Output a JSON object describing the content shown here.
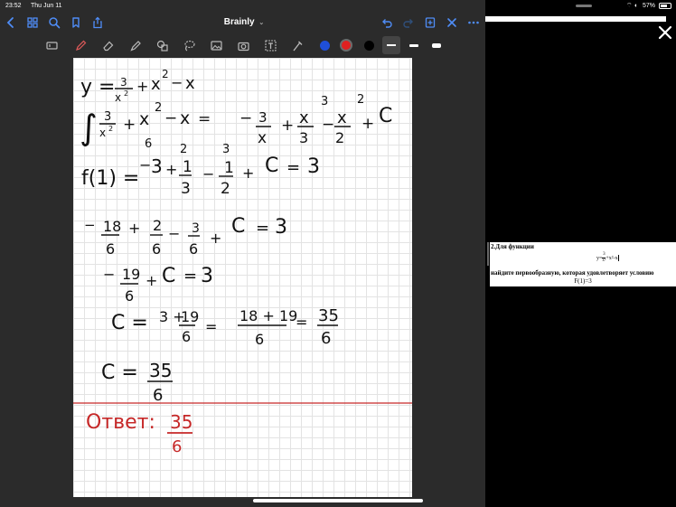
{
  "status_bar": {
    "time": "23:52",
    "date": "Thu Jun 11",
    "battery": "57%"
  },
  "navbar": {
    "title": "Brainly"
  },
  "toolbar": {
    "tools": [
      "text-tool",
      "pen",
      "eraser",
      "highlighter",
      "shapes",
      "lasso",
      "image",
      "camera",
      "textbox",
      "laser"
    ]
  },
  "colors": {
    "ink_blue": "#1f4fd8",
    "ink_red": "#e02020",
    "ink_black": "#000000",
    "answer_red": "#c62828",
    "paper_line": "#e3e3e3"
  },
  "notes": {
    "line1": {
      "y": "y =",
      "frac_num": "3",
      "frac_den": "x",
      "den_exp": "2",
      "plus1": "+",
      "x2_base": "x",
      "x2_exp": "2",
      "minus": "−",
      "x_last": "x"
    },
    "line2": {
      "integral": "∫",
      "i_num": "3",
      "i_den": "x",
      "i_den_exp": "2",
      "plus1": "+",
      "x2_base": "x",
      "x2_exp": "2",
      "minus1": "−",
      "x1": "x",
      "eq": "=",
      "neg": "−",
      "r1_num": "3",
      "r1_den": "x",
      "plus2": "+",
      "r2_num": "x",
      "r2_num_exp": "3",
      "r2_den": "3",
      "minus2": "−",
      "r3_num": "x",
      "r3_num_exp": "2",
      "r3_den": "2",
      "plus3": "+",
      "c": "C"
    },
    "line3": {
      "f": "f(1) =",
      "neg": "−",
      "three": "3",
      "scale1": "6",
      "plus1": "+",
      "a_num": "1",
      "a_den": "3",
      "scale2": "2",
      "minus": "−",
      "b_num": "1",
      "b_den": "2",
      "scale3": "3",
      "plus2": "+",
      "c": "C",
      "eq": "=",
      "val": "3"
    },
    "line4": {
      "neg": "−",
      "a_num": "18",
      "a_den": "6",
      "plus1": "+",
      "b_num": "2",
      "b_den": "6",
      "minus": "−",
      "c_num": "3",
      "c_den": "6",
      "plus2": "+",
      "c": "C",
      "eq": "=",
      "val": "3"
    },
    "line5": {
      "neg": "−",
      "a_num": "19",
      "a_den": "6",
      "plus": "+",
      "c": "C",
      "eq": "=",
      "val": "3"
    },
    "line6": {
      "c": "C =",
      "three": "3 +",
      "a_num": "19",
      "a_den": "6",
      "eq1": "=",
      "b_num": "18 + 19",
      "b_den": "6",
      "eq2": "=",
      "r_num": "35",
      "r_den": "6"
    },
    "line7": {
      "c": "C =",
      "r_num": "35",
      "r_den": "6"
    },
    "answer": {
      "label": "Ответ:",
      "num": "35",
      "den": "6"
    }
  },
  "problem": {
    "line1": "2.Для функции",
    "formula_lhs": "y=",
    "formula_num": "3",
    "formula_den": "x²",
    "formula_rest": "+x²-x",
    "line3": "найдите первообразную, которая удовлетворяет условию",
    "line4": "F(1)=3"
  }
}
